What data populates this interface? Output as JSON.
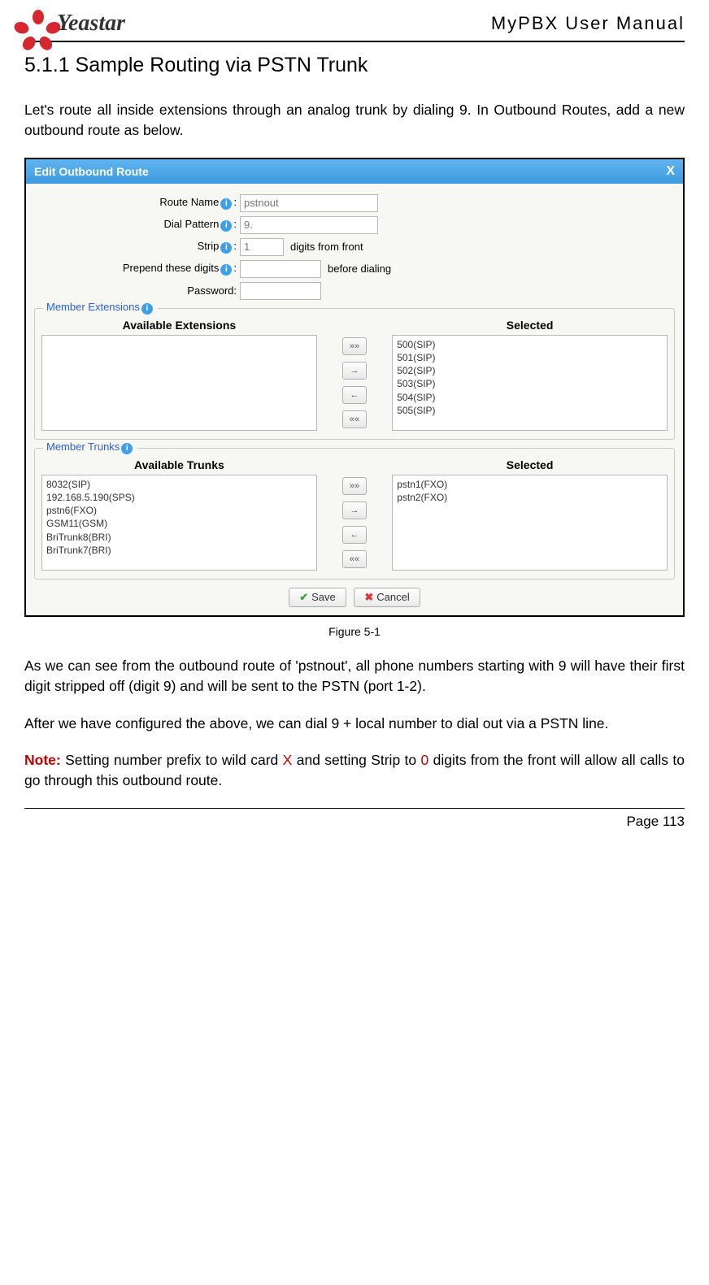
{
  "header": {
    "logo_text": "Yeastar",
    "doc_title": "MyPBX User Manual"
  },
  "section_heading": "5.1.1 Sample Routing via PSTN Trunk",
  "intro_para": "Let's route all inside extensions through an analog trunk by dialing 9. In Outbound Routes, add a new outbound route as below.",
  "modal": {
    "title": "Edit Outbound Route",
    "close": "X",
    "fields": {
      "route_name_label": "Route Name",
      "route_name_value": "pstnout",
      "dial_pattern_label": "Dial Pattern",
      "dial_pattern_value": "9.",
      "strip_label": "Strip",
      "strip_value": "1",
      "strip_after": "digits from front",
      "prepend_label": "Prepend these digits",
      "prepend_value": "",
      "prepend_after": "before dialing",
      "password_label": "Password:",
      "password_value": ""
    },
    "member_ext": {
      "legend": "Member Extensions",
      "avail_header": "Available Extensions",
      "sel_header": "Selected",
      "available": [],
      "selected": [
        "500(SIP)",
        "501(SIP)",
        "502(SIP)",
        "503(SIP)",
        "504(SIP)",
        "505(SIP)"
      ]
    },
    "member_trunks": {
      "legend": "Member Trunks",
      "avail_header": "Available Trunks",
      "sel_header": "Selected",
      "available": [
        "8032(SIP)",
        "192.168.5.190(SPS)",
        "pstn6(FXO)",
        "GSM11(GSM)",
        "BriTrunk8(BRI)",
        "BriTrunk7(BRI)"
      ],
      "selected": [
        "pstn1(FXO)",
        "pstn2(FXO)"
      ]
    },
    "move_btns": {
      "all_right": "»»",
      "right": "→",
      "left": "←",
      "all_left": "««"
    },
    "save_label": "Save",
    "cancel_label": "Cancel"
  },
  "figure_caption": "Figure 5-1",
  "para2": "As we can see from the outbound route of 'pstnout', all phone numbers starting with 9 will have their first digit stripped off (digit 9) and will be sent to the PSTN (port 1-2).",
  "para3": "After we have configured the above, we can dial 9 + local number to dial out via a PSTN line.",
  "note": {
    "prefix": "Note:",
    "t1": " Setting number prefix to wild card ",
    "x": "X",
    "t2": " and setting Strip to ",
    "zero": "0",
    "t3": " digits from the front will allow all calls to go through this outbound route."
  },
  "page_number": "Page 113"
}
